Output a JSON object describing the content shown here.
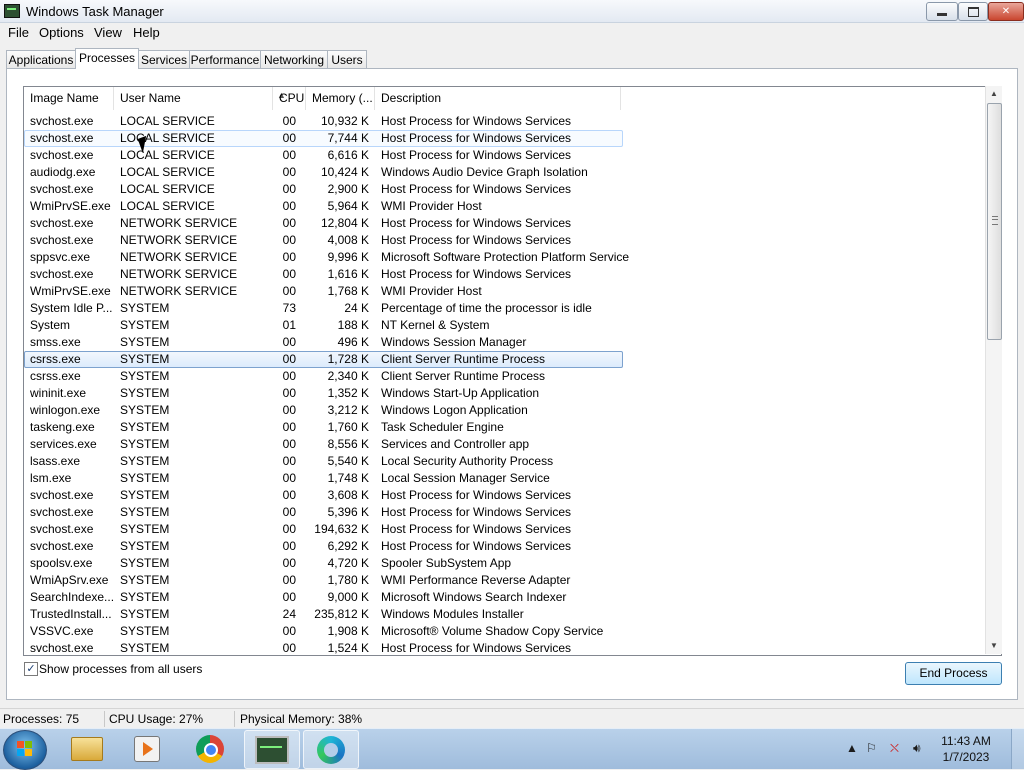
{
  "window": {
    "title": "Windows Task Manager"
  },
  "menu": [
    "File",
    "Options",
    "View",
    "Help"
  ],
  "tabs": [
    "Applications",
    "Processes",
    "Services",
    "Performance",
    "Networking",
    "Users"
  ],
  "columns": [
    "Image Name",
    "User Name",
    "CPU",
    "Memory (...",
    "Description"
  ],
  "processes": [
    {
      "image": "svchost.exe",
      "user": "LOCAL SERVICE",
      "cpu": "00",
      "mem": "10,932 K",
      "desc": "Host Process for Windows Services"
    },
    {
      "image": "svchost.exe",
      "user": "LOCAL SERVICE",
      "cpu": "00",
      "mem": "7,744 K",
      "desc": "Host Process for Windows Services"
    },
    {
      "image": "svchost.exe",
      "user": "LOCAL SERVICE",
      "cpu": "00",
      "mem": "6,616 K",
      "desc": "Host Process for Windows Services"
    },
    {
      "image": "audiodg.exe",
      "user": "LOCAL SERVICE",
      "cpu": "00",
      "mem": "10,424 K",
      "desc": "Windows Audio Device Graph Isolation"
    },
    {
      "image": "svchost.exe",
      "user": "LOCAL SERVICE",
      "cpu": "00",
      "mem": "2,900 K",
      "desc": "Host Process for Windows Services"
    },
    {
      "image": "WmiPrvSE.exe",
      "user": "LOCAL SERVICE",
      "cpu": "00",
      "mem": "5,964 K",
      "desc": "WMI Provider Host"
    },
    {
      "image": "svchost.exe",
      "user": "NETWORK SERVICE",
      "cpu": "00",
      "mem": "12,804 K",
      "desc": "Host Process for Windows Services"
    },
    {
      "image": "svchost.exe",
      "user": "NETWORK SERVICE",
      "cpu": "00",
      "mem": "4,008 K",
      "desc": "Host Process for Windows Services"
    },
    {
      "image": "sppsvc.exe",
      "user": "NETWORK SERVICE",
      "cpu": "00",
      "mem": "9,996 K",
      "desc": "Microsoft Software Protection Platform Service"
    },
    {
      "image": "svchost.exe",
      "user": "NETWORK SERVICE",
      "cpu": "00",
      "mem": "1,616 K",
      "desc": "Host Process for Windows Services"
    },
    {
      "image": "WmiPrvSE.exe",
      "user": "NETWORK SERVICE",
      "cpu": "00",
      "mem": "1,768 K",
      "desc": "WMI Provider Host"
    },
    {
      "image": "System Idle P...",
      "user": "SYSTEM",
      "cpu": "73",
      "mem": "24 K",
      "desc": "Percentage of time the processor is idle"
    },
    {
      "image": "System",
      "user": "SYSTEM",
      "cpu": "01",
      "mem": "188 K",
      "desc": "NT Kernel & System"
    },
    {
      "image": "smss.exe",
      "user": "SYSTEM",
      "cpu": "00",
      "mem": "496 K",
      "desc": "Windows Session Manager"
    },
    {
      "image": "csrss.exe",
      "user": "SYSTEM",
      "cpu": "00",
      "mem": "1,728 K",
      "desc": "Client Server Runtime Process"
    },
    {
      "image": "csrss.exe",
      "user": "SYSTEM",
      "cpu": "00",
      "mem": "2,340 K",
      "desc": "Client Server Runtime Process"
    },
    {
      "image": "wininit.exe",
      "user": "SYSTEM",
      "cpu": "00",
      "mem": "1,352 K",
      "desc": "Windows Start-Up Application"
    },
    {
      "image": "winlogon.exe",
      "user": "SYSTEM",
      "cpu": "00",
      "mem": "3,212 K",
      "desc": "Windows Logon Application"
    },
    {
      "image": "taskeng.exe",
      "user": "SYSTEM",
      "cpu": "00",
      "mem": "1,760 K",
      "desc": "Task Scheduler Engine"
    },
    {
      "image": "services.exe",
      "user": "SYSTEM",
      "cpu": "00",
      "mem": "8,556 K",
      "desc": "Services and Controller app"
    },
    {
      "image": "lsass.exe",
      "user": "SYSTEM",
      "cpu": "00",
      "mem": "5,540 K",
      "desc": "Local Security Authority Process"
    },
    {
      "image": "lsm.exe",
      "user": "SYSTEM",
      "cpu": "00",
      "mem": "1,748 K",
      "desc": "Local Session Manager Service"
    },
    {
      "image": "svchost.exe",
      "user": "SYSTEM",
      "cpu": "00",
      "mem": "3,608 K",
      "desc": "Host Process for Windows Services"
    },
    {
      "image": "svchost.exe",
      "user": "SYSTEM",
      "cpu": "00",
      "mem": "5,396 K",
      "desc": "Host Process for Windows Services"
    },
    {
      "image": "svchost.exe",
      "user": "SYSTEM",
      "cpu": "00",
      "mem": "194,632 K",
      "desc": "Host Process for Windows Services"
    },
    {
      "image": "svchost.exe",
      "user": "SYSTEM",
      "cpu": "00",
      "mem": "6,292 K",
      "desc": "Host Process for Windows Services"
    },
    {
      "image": "spoolsv.exe",
      "user": "SYSTEM",
      "cpu": "00",
      "mem": "4,720 K",
      "desc": "Spooler SubSystem App"
    },
    {
      "image": "WmiApSrv.exe",
      "user": "SYSTEM",
      "cpu": "00",
      "mem": "1,780 K",
      "desc": "WMI Performance Reverse Adapter"
    },
    {
      "image": "SearchIndexe...",
      "user": "SYSTEM",
      "cpu": "00",
      "mem": "9,000 K",
      "desc": "Microsoft Windows Search Indexer"
    },
    {
      "image": "TrustedInstall...",
      "user": "SYSTEM",
      "cpu": "24",
      "mem": "235,812 K",
      "desc": "Windows Modules Installer"
    },
    {
      "image": "VSSVC.exe",
      "user": "SYSTEM",
      "cpu": "00",
      "mem": "1,908 K",
      "desc": "Microsoft® Volume Shadow Copy Service"
    },
    {
      "image": "svchost.exe",
      "user": "SYSTEM",
      "cpu": "00",
      "mem": "1,524 K",
      "desc": "Host Process for Windows Services"
    }
  ],
  "selected_row": 14,
  "hover_row": 1,
  "show_all_users": {
    "label": "Show processes from all users",
    "checked": true
  },
  "end_process_label": "End Process",
  "status": {
    "processes": "Processes: 75",
    "cpu": "CPU Usage: 27%",
    "memory": "Physical Memory: 38%"
  },
  "taskbar": {
    "apps": [
      "windows-explorer-icon",
      "media-player-icon",
      "chrome-icon",
      "task-manager-icon",
      "edge-icon"
    ],
    "clock_time": "11:43 AM",
    "clock_date": "1/7/2023"
  }
}
